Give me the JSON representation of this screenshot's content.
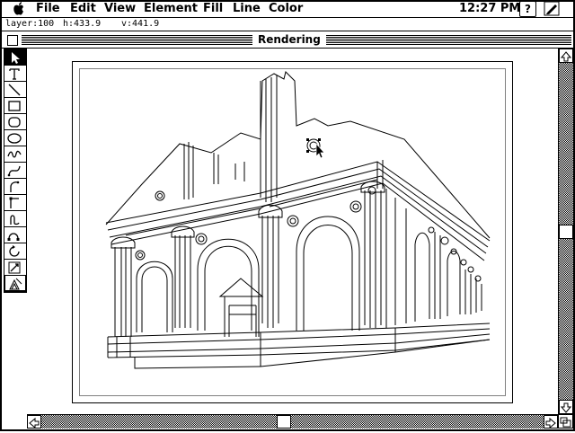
{
  "menubar": {
    "items": [
      "File",
      "Edit",
      "View",
      "Element",
      "Fill",
      "Line",
      "Color"
    ],
    "clock": "12:27 PM",
    "help_icon": "?"
  },
  "status": {
    "layer": "layer:100",
    "h": "h:433.9",
    "v": "v:441.9"
  },
  "window": {
    "title": "Rendering"
  },
  "toolbox": {
    "tools": [
      "pointer-tool",
      "text-tool",
      "line-tool",
      "rectangle-tool",
      "rounded-rectangle-tool",
      "oval-tool",
      "freehand-tool",
      "bezier-curve-tool",
      "arc-tool",
      "corner-tool",
      "corner-curve-tool",
      "connector-tool",
      "rotate-tool",
      "scale-tool",
      "skew-tool",
      "blend-tool"
    ]
  }
}
